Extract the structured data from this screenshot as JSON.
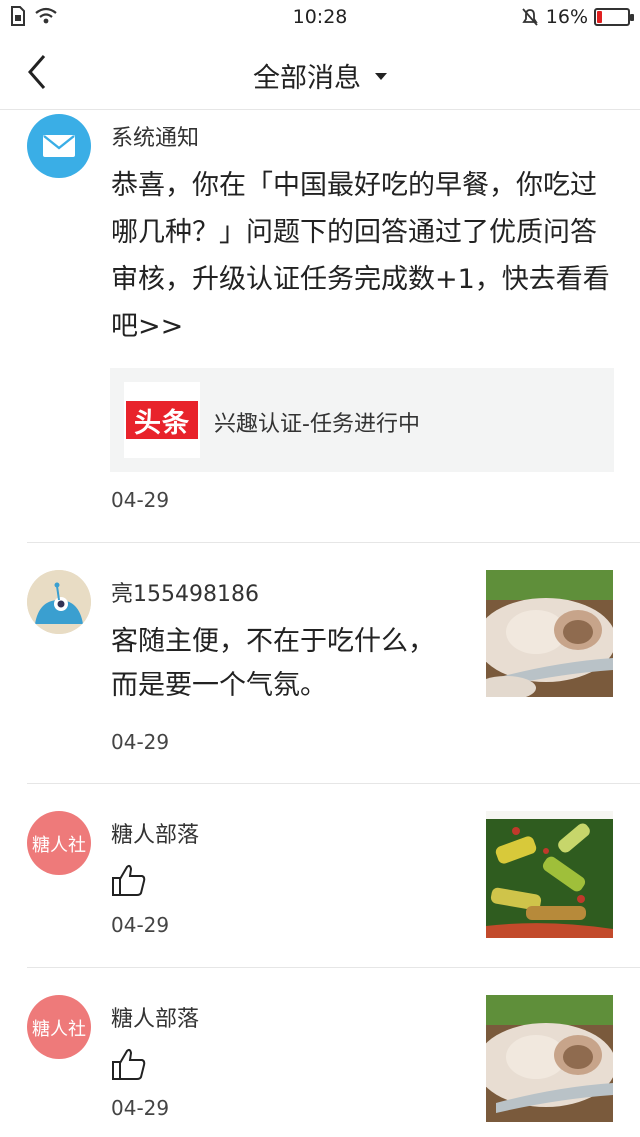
{
  "status_bar": {
    "time": "10:28",
    "battery": "16%",
    "battery_level": 0.16,
    "battery_color": "#e02020"
  },
  "nav": {
    "title": "全部消息",
    "back_icon": "chevron-left-icon",
    "dropdown_icon": "caret-down-icon"
  },
  "messages": [
    {
      "sender": "系统通知",
      "avatar_icon": "mail-icon",
      "avatar_color": "#3aaee6",
      "text": "恭喜，你在「中国最好吃的早餐，你吃过哪几种？」问题下的回答通过了优质问答审核，升级认证任务完成数+1，快去看看吧>>",
      "card": {
        "logo_text": "头条",
        "logo_color": "#e8232b",
        "title": "兴趣认证-任务进行中"
      },
      "date": "04-29"
    },
    {
      "sender": "亮155498186",
      "text": "客随主便，不在于吃什么，而是要一个气氛。",
      "thumbnail": "dumplings-image",
      "date": "04-29"
    },
    {
      "sender": "糖人部落",
      "avatar_text": "糖人社",
      "avatar_color": "#ee7a7a",
      "like_icon": "thumbs-up-icon",
      "thumbnail": "cucumber-salad-image",
      "date": "04-29"
    },
    {
      "sender": "糖人部落",
      "avatar_text": "糖人社",
      "avatar_color": "#ee7a7a",
      "like_icon": "thumbs-up-icon",
      "thumbnail": "dumplings-image",
      "date": "04-29"
    }
  ]
}
